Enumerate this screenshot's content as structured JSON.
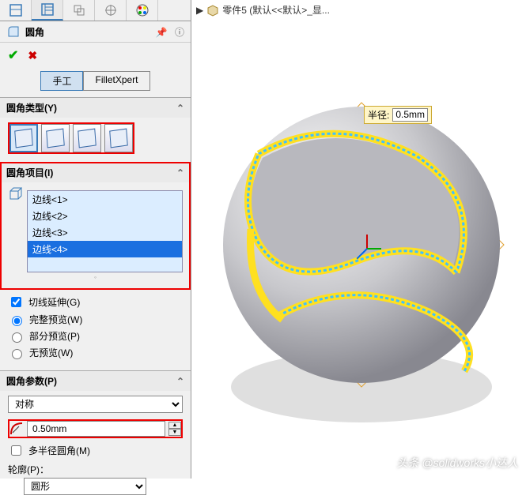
{
  "breadcrumb": {
    "part": "零件5 (默认<<默认>_显..."
  },
  "feature": {
    "title": "圆角"
  },
  "modes": {
    "manual": "手工",
    "xpert": "FilletXpert"
  },
  "sections": {
    "type": {
      "title": "圆角类型(Y)"
    },
    "items": {
      "title": "圆角项目(I)",
      "edges": [
        "边线<1>",
        "边线<2>",
        "边线<3>",
        "边线<4>"
      ],
      "tangent": "切线延伸(G)",
      "full_preview": "完整预览(W)",
      "part_preview": "部分预览(P)",
      "no_preview": "无预览(W)"
    },
    "params": {
      "title": "圆角参数(P)",
      "symmetry": "对称",
      "radius": "0.50mm",
      "multi": "多半径圆角(M)"
    },
    "profile": {
      "title": "轮廓(P)：",
      "value": "圆形"
    }
  },
  "callout": {
    "label": "半径:",
    "value": "0.5mm"
  },
  "watermark": "头条 @solidworks小达人"
}
